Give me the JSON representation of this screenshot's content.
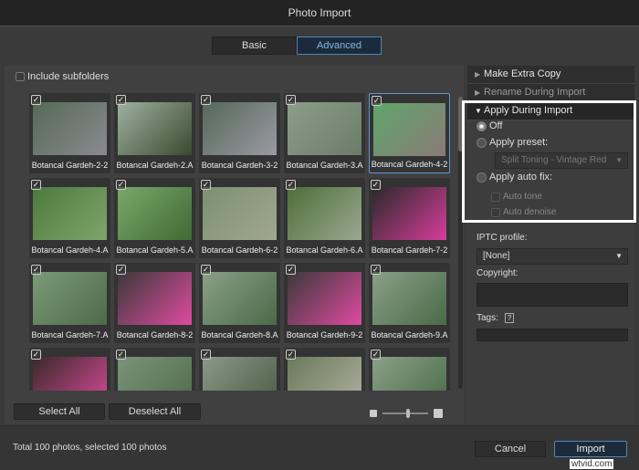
{
  "window": {
    "title": "Photo Import"
  },
  "tabs": [
    {
      "label": "Basic",
      "active": false
    },
    {
      "label": "Advanced",
      "active": true
    }
  ],
  "left": {
    "include_subfolders": "Include subfolders",
    "include_subfolders_checked": false,
    "photos": [
      {
        "name": "Botancal Gardeh-2-2",
        "checked": true,
        "colors": [
          "#556a55",
          "#8a8a90"
        ]
      },
      {
        "name": "Botancal Gardeh-2.A",
        "checked": true,
        "colors": [
          "#9fb0a0",
          "#3a4a30"
        ]
      },
      {
        "name": "Botancal Gardeh-3-2",
        "checked": true,
        "colors": [
          "#55685a",
          "#9a9aa2"
        ]
      },
      {
        "name": "Botancal Gardeh-3.A",
        "checked": true,
        "colors": [
          "#8c9e8a",
          "#6b7c68"
        ]
      },
      {
        "name": "Botancal Gardeh-4-2",
        "checked": true,
        "selected": true,
        "colors": [
          "#5fa66a",
          "#8a7a78"
        ]
      },
      {
        "name": "Botancal Gardeh-4.A",
        "checked": true,
        "colors": [
          "#4c7a3e",
          "#7fa56a"
        ]
      },
      {
        "name": "Botancal Gardeh-5.A",
        "checked": true,
        "colors": [
          "#7aa86a",
          "#3f6a34"
        ]
      },
      {
        "name": "Botancal Gardeh-6-2",
        "checked": true,
        "colors": [
          "#7d8f70",
          "#a0a890"
        ]
      },
      {
        "name": "Botancal Gardeh-6.A",
        "checked": true,
        "colors": [
          "#4f6e3a",
          "#9aa890"
        ]
      },
      {
        "name": "Botancal Gardeh-7-2",
        "checked": true,
        "colors": [
          "#2a2a2a",
          "#d83c9a"
        ]
      },
      {
        "name": "Botancal Gardeh-7.A",
        "checked": true,
        "colors": [
          "#7a9a78",
          "#4c6a48"
        ]
      },
      {
        "name": "Botancal Gardeh-8-2",
        "checked": true,
        "colors": [
          "#3a3a3a",
          "#e04aa0"
        ]
      },
      {
        "name": "Botancal Gardeh-8.A",
        "checked": true,
        "colors": [
          "#8aa088",
          "#4a6a48"
        ]
      },
      {
        "name": "Botancal Gardeh-9-2",
        "checked": true,
        "colors": [
          "#3a3a3a",
          "#e04aa0"
        ]
      },
      {
        "name": "Botancal Gardeh-9.A",
        "checked": true,
        "colors": [
          "#8aa088",
          "#4a6a48"
        ]
      },
      {
        "name": "",
        "checked": true,
        "colors": [
          "#3a2a2a",
          "#d84a9a"
        ]
      },
      {
        "name": "",
        "checked": true,
        "colors": [
          "#7a9478",
          "#506a4a"
        ]
      },
      {
        "name": "",
        "checked": true,
        "colors": [
          "#8a9a88",
          "#4a5a44"
        ]
      },
      {
        "name": "",
        "checked": true,
        "colors": [
          "#6a7a5a",
          "#b0b0a0"
        ]
      },
      {
        "name": "",
        "checked": true,
        "colors": [
          "#8aa088",
          "#4a6a48"
        ]
      }
    ],
    "select_all": "Select All",
    "deselect_all": "Deselect All",
    "thumb_size_level": 0.55
  },
  "right": {
    "make_extra_copy": "Make Extra Copy",
    "rename_during_import": "Rename During Import",
    "apply_during_import": "Apply During Import",
    "off": "Off",
    "apply_preset": "Apply preset:",
    "preset_value": "Split Toning - Vintage Red",
    "apply_auto_fix": "Apply auto fix:",
    "auto_tone": "Auto tone",
    "auto_denoise": "Auto denoise",
    "iptc_label": "IPTC profile:",
    "iptc_value": "[None]",
    "copyright_label": "Copyright:",
    "copyright_value": "",
    "tags_label": "Tags:",
    "tags_help": "?",
    "tags_value": ""
  },
  "footer": {
    "status": "Total 100 photos, selected 100 photos",
    "cancel": "Cancel",
    "import": "Import",
    "watermark": "wtvid.com"
  }
}
